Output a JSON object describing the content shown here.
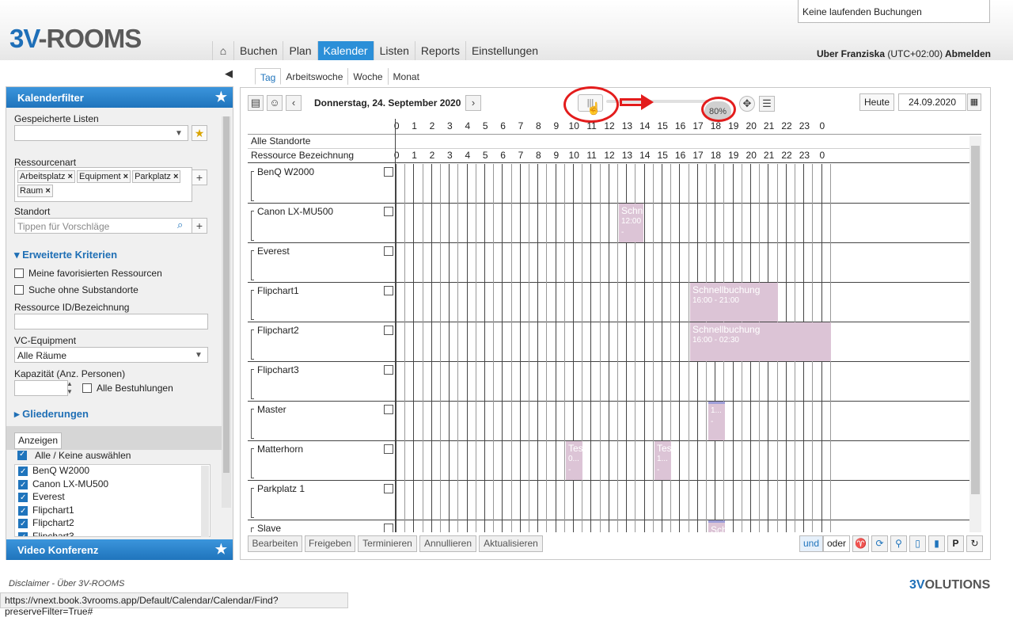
{
  "app": {
    "logo_prefix": "3V",
    "logo_suffix": "-ROOMS",
    "booking_status": "Keine laufenden Buchungen"
  },
  "nav": {
    "home": "⌂",
    "items": [
      "Buchen",
      "Plan",
      "Kalender",
      "Listen",
      "Reports",
      "Einstellungen"
    ],
    "active": "Kalender"
  },
  "user": {
    "name": "Uber Franziska",
    "tz": "(UTC+02:00)",
    "logout": "Abmelden"
  },
  "sidebar": {
    "title": "Kalenderfilter",
    "saved_lists_label": "Gespeicherte Listen",
    "resource_type_label": "Ressourcenart",
    "resource_tags": [
      "Arbeitsplatz",
      "Equipment",
      "Parkplatz",
      "Raum"
    ],
    "location_label": "Standort",
    "location_placeholder": "Tippen für Vorschläge",
    "extended_label": "Erweiterte Kriterien",
    "fav_label": "Meine favorisierten Ressourcen",
    "nosub_label": "Suche ohne Substandorte",
    "resid_label": "Ressource ID/Bezeichnung",
    "vc_label": "VC-Equipment",
    "vc_value": "Alle Räume",
    "capacity_label": "Kapazität (Anz. Personen)",
    "all_seating_label": "Alle Bestuhlungen",
    "structure_label": "Gliederungen",
    "show_button": "Anzeigen",
    "select_all_label": "Alle / Keine auswählen",
    "resources": [
      "BenQ W2000",
      "Canon LX-MU500",
      "Everest",
      "Flipchart1",
      "Flipchart2",
      "Flipchart3"
    ],
    "video_title": "Video Konferenz"
  },
  "view_tabs": [
    "Tag",
    "Arbeitswoche",
    "Woche",
    "Monat"
  ],
  "toolbar": {
    "date_title": "Donnerstag, 24. September 2020",
    "zoom": "80%",
    "today": "Heute",
    "date": "24.09.2020"
  },
  "grid": {
    "hours": [
      "0",
      "1",
      "2",
      "3",
      "4",
      "5",
      "6",
      "7",
      "8",
      "9",
      "10",
      "11",
      "12",
      "13",
      "14",
      "15",
      "16",
      "17",
      "18",
      "19",
      "20",
      "21",
      "22",
      "23",
      "0"
    ],
    "all_locations": "Alle Standorte",
    "resource_header": "Ressource Bezeichnung",
    "rows": [
      "BenQ W2000",
      "Canon LX-MU500",
      "Everest",
      "Flipchart1",
      "Flipchart2",
      "Flipchart3",
      "Master",
      "Matterhorn",
      "Parkplatz 1",
      "Slave"
    ],
    "bookings": {
      "canon": {
        "title": "Schn",
        "time": "12:00",
        "extra": "-"
      },
      "flip1": {
        "title": "Schnellbuchung",
        "time": "16:00 - 21:00"
      },
      "flip2": {
        "title": "Schnellbuchung",
        "time": "16:00 - 02:30"
      },
      "master": {
        "title": "1...",
        "extra": "-"
      },
      "matter1": {
        "title": "Tes",
        "time": "0...",
        "extra": "-"
      },
      "matter2": {
        "title": "Tes",
        "time": "1...",
        "extra": "-"
      },
      "slave": {
        "title": "Sch"
      }
    }
  },
  "actions": [
    "Bearbeiten",
    "Freigeben",
    "Terminieren",
    "Annullieren",
    "Aktualisieren"
  ],
  "logic": {
    "and": "und",
    "or": "oder"
  },
  "footer": {
    "disclaimer": "Disclaimer",
    "sep": "-",
    "about": "Über 3V-ROOMS",
    "url": "https://vnext.book.3vrooms.app/Default/Calendar/Calendar/Find?preserveFilter=True#",
    "brand_prefix": "3V",
    "brand_suffix": "OLUTIONS"
  },
  "colors": {
    "accent": "#2b8fd8",
    "booking": "#dcc4d6",
    "annotation": "#e31c1c"
  }
}
